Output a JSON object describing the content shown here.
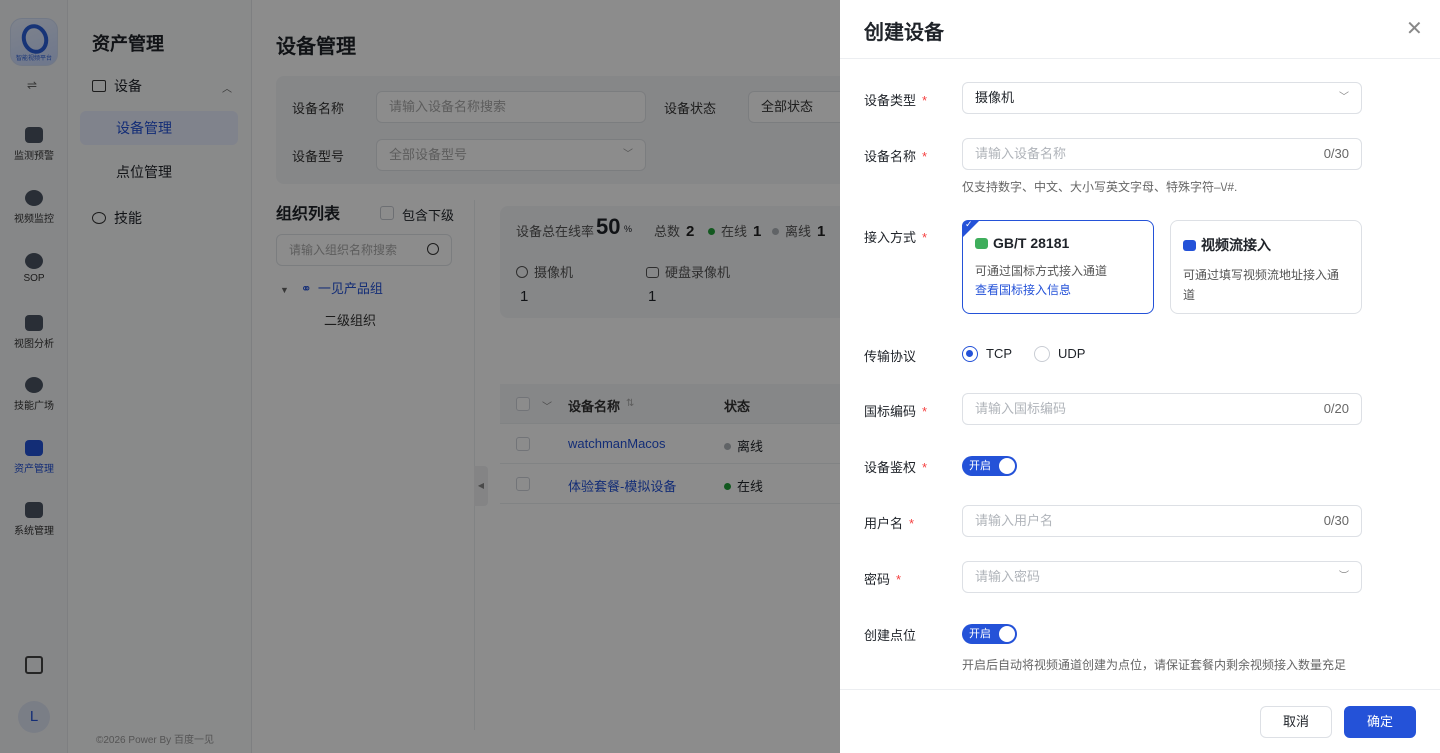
{
  "rail": {
    "logo_caption": "智能视频平台",
    "items": [
      {
        "label": "监测预警",
        "icon": "chart-icon"
      },
      {
        "label": "视频监控",
        "icon": "camera-lens-icon"
      },
      {
        "label": "SOP",
        "icon": "sop-icon"
      },
      {
        "label": "视图分析",
        "icon": "view-analysis-icon"
      },
      {
        "label": "技能广场",
        "icon": "skills-icon"
      },
      {
        "label": "资产管理",
        "icon": "assets-icon"
      },
      {
        "label": "系统管理",
        "icon": "system-icon"
      }
    ],
    "avatar": "L"
  },
  "nav": {
    "title": "资产管理",
    "device_group": "设备",
    "sub_items": [
      "设备管理",
      "点位管理"
    ],
    "skills": "技能",
    "footer": "©2026 Power By 百度一见"
  },
  "main": {
    "title": "设备管理",
    "filters": {
      "name_label": "设备名称",
      "name_placeholder": "请输入设备名称搜索",
      "status_label": "设备状态",
      "status_value": "全部状态",
      "model_label": "设备型号",
      "model_value": "全部设备型号"
    },
    "org": {
      "title": "组织列表",
      "include_sub": "包含下级",
      "search_placeholder": "请输入组织名称搜索",
      "node1": "一见产品组",
      "node2": "二级组织"
    },
    "stats": {
      "online_rate_label": "设备总在线率",
      "online_rate": "50",
      "online_rate_unit": "%",
      "total_label": "总数",
      "total": "2",
      "online_label": "在线",
      "online": "1",
      "offline_label": "离线",
      "offline": "1",
      "camera_label": "摄像机",
      "camera": "1",
      "nvr_label": "硬盘录像机",
      "nvr": "1"
    },
    "table": {
      "headers": [
        "设备名称",
        "状态"
      ],
      "rows": [
        {
          "name": "watchmanMacos",
          "status": "离线",
          "status_color": "#b0b4ba"
        },
        {
          "name": "体验套餐-模拟设备",
          "status": "在线",
          "status_color": "#22a03a"
        }
      ]
    }
  },
  "drawer": {
    "title": "创建设备",
    "device_type_label": "设备类型",
    "device_type_value": "摄像机",
    "device_name_label": "设备名称",
    "device_name_placeholder": "请输入设备名称",
    "device_name_count": "0/30",
    "device_name_hint": "仅支持数字、中文、大小写英文字母、特殊字符–\\/#.",
    "access_label": "接入方式",
    "access_cards": [
      {
        "title": "GB/T 28181",
        "desc": "可通过国标方式接入通道",
        "link": "查看国标接入信息"
      },
      {
        "title": "视频流接入",
        "desc": "可通过填写视频流地址接入通道"
      }
    ],
    "protocol_label": "传输协议",
    "protocol_options": [
      "TCP",
      "UDP"
    ],
    "protocol_selected": "TCP",
    "gb_code_label": "国标编码",
    "gb_code_placeholder": "请输入国标编码",
    "gb_code_count": "0/20",
    "auth_label": "设备鉴权",
    "auth_toggle": "开启",
    "username_label": "用户名",
    "username_placeholder": "请输入用户名",
    "username_count": "0/30",
    "password_label": "密码",
    "password_placeholder": "请输入密码",
    "create_point_label": "创建点位",
    "create_point_toggle": "开启",
    "create_point_hint": "开启后自动将视频通道创建为点位，请保证套餐内剩余视频接入数量充足",
    "cancel": "取消",
    "confirm": "确定",
    "accent_color": "#2452d8"
  }
}
